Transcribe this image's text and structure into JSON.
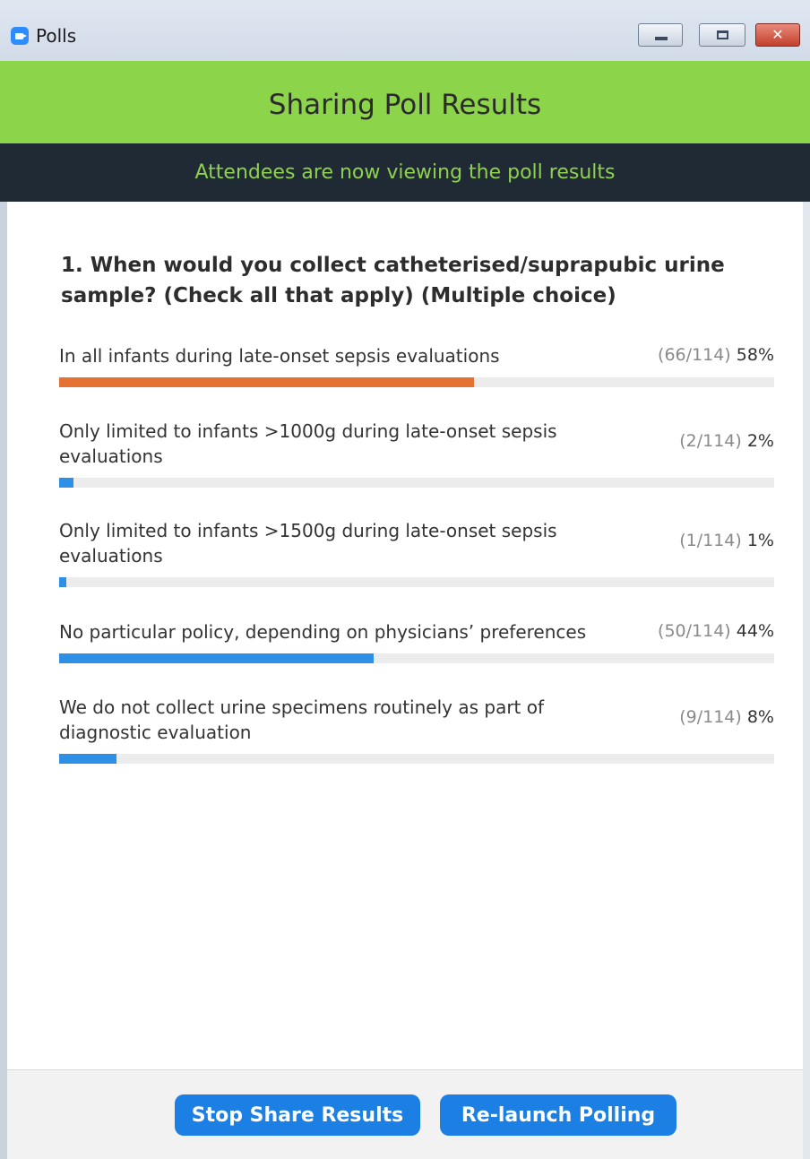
{
  "window": {
    "title": "Polls",
    "icon": "zoom-camera-icon",
    "controls": {
      "minimize": "minimize-icon",
      "maximize": "maximize-icon",
      "close": "✕"
    }
  },
  "header": {
    "title": "Sharing Poll Results",
    "status": "Attendees are now viewing the poll results",
    "colors": {
      "header_bg": "#8cd449",
      "status_bg": "#1f2a34",
      "status_text": "#8fd14f"
    }
  },
  "poll": {
    "question": "1. When would you collect catheterised/suprapubic urine sample? (Check all that apply) (Multiple choice)",
    "options": [
      {
        "label": "In all infants during late-onset sepsis evaluations",
        "count": "(66/114)",
        "percent": "58%",
        "fraction": 0.58,
        "color": "#e57233"
      },
      {
        "label": "Only limited to infants >1000g during late-onset sepsis evaluations",
        "count": "(2/114)",
        "percent": "2%",
        "fraction": 0.02,
        "color": "#2d8fe6"
      },
      {
        "label": "Only limited to infants >1500g during late-onset sepsis evaluations",
        "count": "(1/114)",
        "percent": "1%",
        "fraction": 0.01,
        "color": "#2d8fe6"
      },
      {
        "label": "No particular policy, depending on physicians’ preferences",
        "count": "(50/114)",
        "percent": "44%",
        "fraction": 0.44,
        "color": "#2d8fe6"
      },
      {
        "label": "We do not collect urine specimens routinely as part of diagnostic evaluation",
        "count": "(9/114)",
        "percent": "8%",
        "fraction": 0.08,
        "color": "#2d8fe6"
      }
    ]
  },
  "footer": {
    "stop_share_label": "Stop Share Results",
    "relaunch_label": "Re-launch Polling",
    "button_color": "#1c7fe3"
  }
}
